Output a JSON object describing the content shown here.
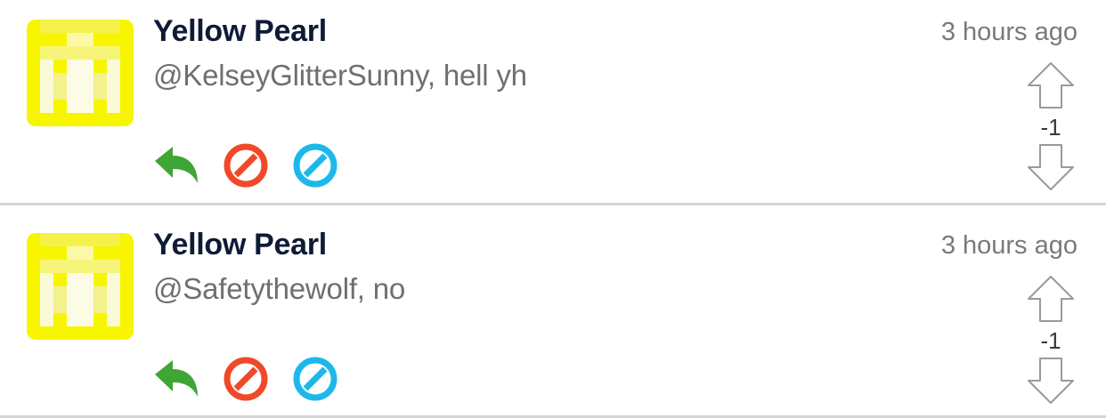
{
  "comments": [
    {
      "username": "Yellow Pearl",
      "message": "@KelseyGlitterSunny, hell yh",
      "timestamp": "3 hours ago",
      "score": "-1"
    },
    {
      "username": "Yellow Pearl",
      "message": "@Safetythewolf, no",
      "timestamp": "3 hours ago",
      "score": "-1"
    }
  ],
  "icons": {
    "reply": "reply-arrow-icon",
    "block_red": "block-icon",
    "block_blue": "ignore-icon",
    "upvote": "upvote-arrow-icon",
    "downvote": "downvote-arrow-icon"
  },
  "colors": {
    "username": "#0e1b36",
    "reply_green": "#3fa535",
    "block_red": "#f0492a",
    "block_blue": "#1db8ea",
    "avatar_yellow": "#f7f500"
  }
}
